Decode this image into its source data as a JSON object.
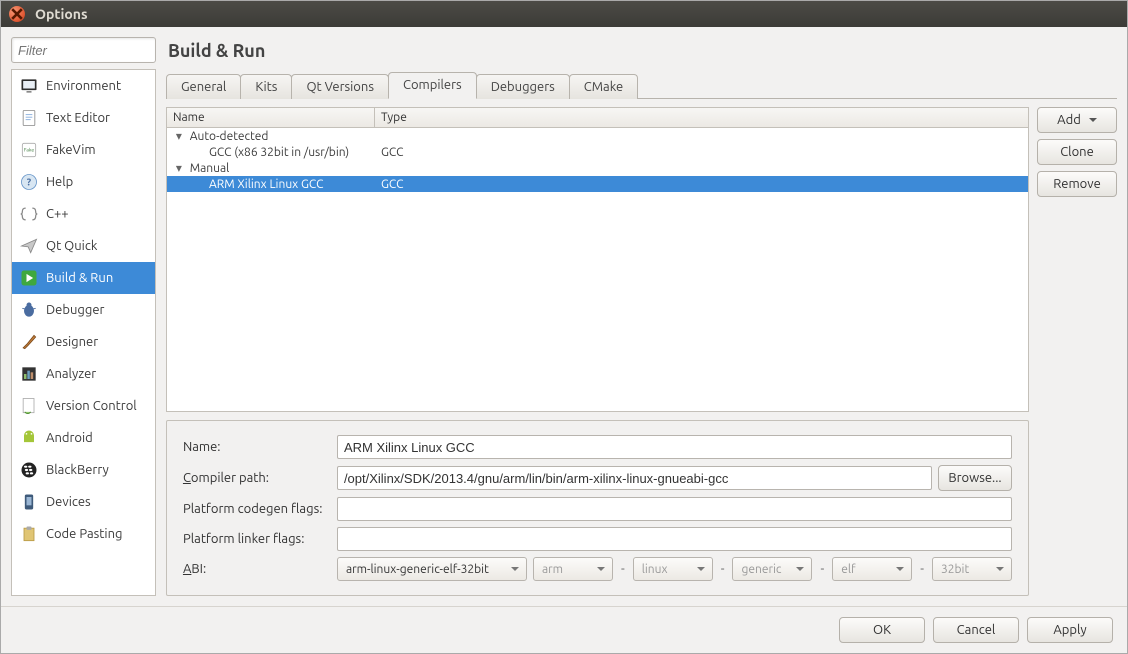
{
  "window": {
    "title": "Options"
  },
  "filter": {
    "placeholder": "Filter"
  },
  "sidebar": {
    "items": [
      {
        "label": "Environment"
      },
      {
        "label": "Text Editor"
      },
      {
        "label": "FakeVim"
      },
      {
        "label": "Help"
      },
      {
        "label": "C++"
      },
      {
        "label": "Qt Quick"
      },
      {
        "label": "Build & Run"
      },
      {
        "label": "Debugger"
      },
      {
        "label": "Designer"
      },
      {
        "label": "Analyzer"
      },
      {
        "label": "Version Control"
      },
      {
        "label": "Android"
      },
      {
        "label": "BlackBerry"
      },
      {
        "label": "Devices"
      },
      {
        "label": "Code Pasting"
      }
    ]
  },
  "page": {
    "title": "Build & Run"
  },
  "tabs": {
    "items": [
      {
        "label": "General"
      },
      {
        "label": "Kits"
      },
      {
        "label": "Qt Versions"
      },
      {
        "label": "Compilers"
      },
      {
        "label": "Debuggers"
      },
      {
        "label": "CMake"
      }
    ]
  },
  "tree": {
    "headers": {
      "name": "Name",
      "type": "Type"
    },
    "groups": [
      {
        "label": "Auto-detected",
        "children": [
          {
            "name": "GCC (x86 32bit in /usr/bin)",
            "type": "GCC"
          }
        ]
      },
      {
        "label": "Manual",
        "children": [
          {
            "name": "ARM Xilinx Linux GCC",
            "type": "GCC"
          }
        ]
      }
    ]
  },
  "buttons": {
    "add": "Add",
    "clone": "Clone",
    "remove": "Remove",
    "browse": "Browse...",
    "ok": "OK",
    "cancel": "Cancel",
    "apply": "Apply"
  },
  "form": {
    "labels": {
      "name": "Name:",
      "compiler_path": "ompiler path:",
      "codegen": "Platform codegen flags:",
      "linker": "Platform linker flags:",
      "abi": "BI:"
    },
    "name_value": "ARM Xilinx Linux GCC",
    "compiler_path_value": "/opt/Xilinx/SDK/2013.4/gnu/arm/lin/bin/arm-xilinx-linux-gnueabi-gcc",
    "codegen_value": "",
    "linker_value": "",
    "abi": {
      "combined": "arm-linux-generic-elf-32bit",
      "parts": [
        "arm",
        "linux",
        "generic",
        "elf",
        "32bit"
      ]
    }
  }
}
